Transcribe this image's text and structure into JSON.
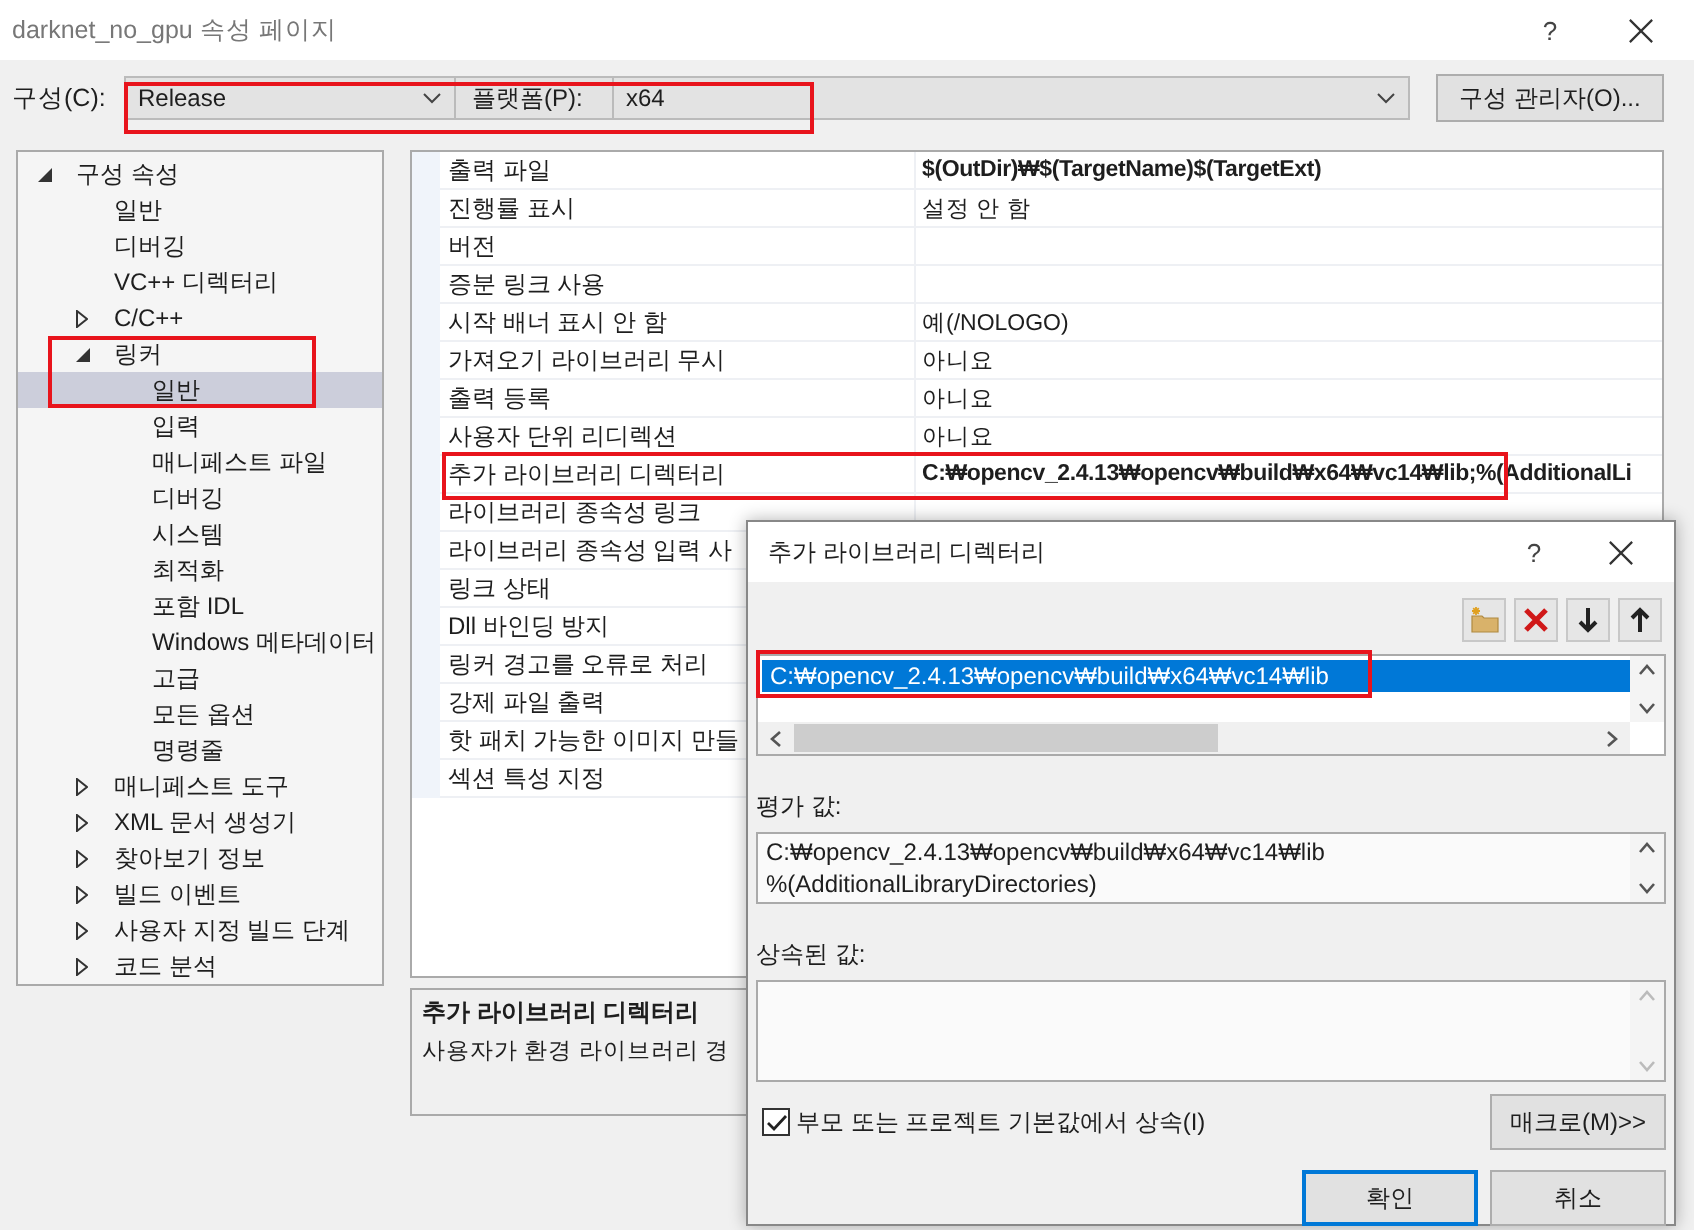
{
  "window": {
    "title": "darknet_no_gpu 속성 페이지",
    "help": "?"
  },
  "toolbar": {
    "config_label": "구성(C):",
    "config_value": "Release",
    "platform_label": "플랫폼(P):",
    "platform_value": "x64",
    "manager_button": "구성 관리자(O)..."
  },
  "tree": [
    {
      "label": "구성 속성",
      "expanded": true,
      "selected": false,
      "children": [
        {
          "label": "일반",
          "selected": false
        },
        {
          "label": "디버깅",
          "selected": false
        },
        {
          "label": "VC++ 디렉터리",
          "selected": false
        },
        {
          "label": "C/C++",
          "expanded": false,
          "selected": false
        },
        {
          "label": "링커",
          "expanded": true,
          "selected": false,
          "children": [
            {
              "label": "일반",
              "selected": true
            },
            {
              "label": "입력",
              "selected": false
            },
            {
              "label": "매니페스트 파일",
              "selected": false
            },
            {
              "label": "디버깅",
              "selected": false
            },
            {
              "label": "시스템",
              "selected": false
            },
            {
              "label": "최적화",
              "selected": false
            },
            {
              "label": "포함 IDL",
              "selected": false
            },
            {
              "label": "Windows 메타데이터",
              "selected": false
            },
            {
              "label": "고급",
              "selected": false
            },
            {
              "label": "모든 옵션",
              "selected": false
            },
            {
              "label": "명령줄",
              "selected": false
            }
          ]
        },
        {
          "label": "매니페스트 도구",
          "expanded": false,
          "selected": false
        },
        {
          "label": "XML 문서 생성기",
          "expanded": false,
          "selected": false
        },
        {
          "label": "찾아보기 정보",
          "expanded": false,
          "selected": false
        },
        {
          "label": "빌드 이벤트",
          "expanded": false,
          "selected": false
        },
        {
          "label": "사용자 지정 빌드 단계",
          "expanded": false,
          "selected": false
        },
        {
          "label": "코드 분석",
          "expanded": false,
          "selected": false
        }
      ]
    }
  ],
  "properties": [
    {
      "name": "출력 파일",
      "value": "$(OutDir)₩$(TargetName)$(TargetExt)",
      "bold": true
    },
    {
      "name": "진행률 표시",
      "value": "설정 안 함",
      "bold": false
    },
    {
      "name": "버전"
    },
    {
      "name": "증분 링크 사용"
    },
    {
      "name": "시작 배너 표시 안 함",
      "value": "예(/NOLOGO)",
      "bold": false
    },
    {
      "name": "가져오기 라이브러리 무시",
      "value": "아니요",
      "bold": false
    },
    {
      "name": "출력 등록",
      "value": "아니요",
      "bold": false
    },
    {
      "name": "사용자 단위 리디렉션",
      "value": "아니요",
      "bold": false
    },
    {
      "name": "추가 라이브러리 디렉터리",
      "value": "C:₩opencv_2.4.13₩opencv₩build₩x64₩vc14₩lib;%(AdditionalLi",
      "bold": true
    },
    {
      "name": "라이브러리 종속성 링크"
    },
    {
      "name": "라이브러리 종속성 입력 사"
    },
    {
      "name": "링크 상태"
    },
    {
      "name": "Dll 바인딩 방지"
    },
    {
      "name": "링커 경고를 오류로 처리"
    },
    {
      "name": "강제 파일 출력"
    },
    {
      "name": "핫 패치 가능한 이미지 만들"
    },
    {
      "name": "섹션 특성 지정"
    }
  ],
  "description": {
    "title": "추가 라이브러리 디렉터리",
    "text": "사용자가 환경 라이브러리 경"
  },
  "dialog": {
    "title": "추가 라이브러리 디렉터리",
    "help": "?",
    "items": [
      {
        "text": "C:₩opencv_2.4.13₩opencv₩build₩x64₩vc14₩lib",
        "selected": true
      }
    ],
    "evaluated_label": "평가 값:",
    "evaluated_lines": [
      "C:₩opencv_2.4.13₩opencv₩build₩x64₩vc14₩lib",
      "%(AdditionalLibraryDirectories)"
    ],
    "inherited_label": "상속된 값:",
    "inherit_checkbox": {
      "label": "부모 또는 프로젝트 기본값에서 상속(I)",
      "checked": true
    },
    "macro_button": "매크로(M)>>",
    "ok_button": "확인",
    "cancel_button": "취소"
  }
}
